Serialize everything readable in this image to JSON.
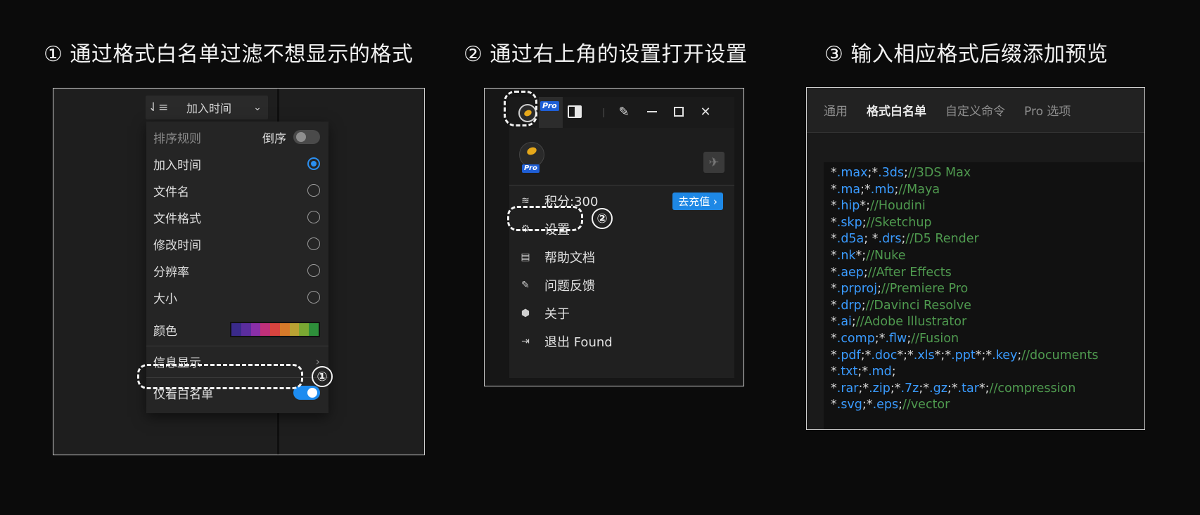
{
  "steps": [
    {
      "title": "① 通过格式白名单过滤不想显示的格式"
    },
    {
      "title": "② 通过右上角的设置打开设置"
    },
    {
      "title": "③ 输入相应格式后缀添加预览"
    }
  ],
  "panel1": {
    "sort_button": {
      "label": "加入时间",
      "icon": "sort-icon",
      "chevron": "chevron-down-icon"
    },
    "menu": {
      "header": "排序规则",
      "descending_label": "倒序",
      "descending_on": false,
      "options": [
        {
          "label": "加入时间",
          "selected": true
        },
        {
          "label": "文件名",
          "selected": false
        },
        {
          "label": "文件格式",
          "selected": false
        },
        {
          "label": "修改时间",
          "selected": false
        },
        {
          "label": "分辨率",
          "selected": false
        },
        {
          "label": "大小",
          "selected": false
        }
      ],
      "color_label": "颜色",
      "palette": [
        "#3a2a8a",
        "#5b2d9e",
        "#8a2fa8",
        "#c0307a",
        "#d9443f",
        "#d67a2a",
        "#b9a233",
        "#7aa832",
        "#2e8f3a"
      ],
      "info_label": "信息显示",
      "whitelist_label": "仅看白名单",
      "whitelist_on": true
    },
    "marker": "①"
  },
  "panel2": {
    "pro_badge": "Pro",
    "avatar_badge": "Pro",
    "menu": [
      {
        "icon": "database-icon",
        "label": "积分:300",
        "action": "去充值 ›"
      },
      {
        "icon": "gear-icon",
        "label": "设置"
      },
      {
        "icon": "document-icon",
        "label": "帮助文档"
      },
      {
        "icon": "feedback-icon",
        "label": "问题反馈"
      },
      {
        "icon": "hexagon-icon",
        "label": "关于"
      },
      {
        "icon": "logout-icon",
        "label": "退出 Found"
      }
    ],
    "marker": "②"
  },
  "panel3": {
    "tabs": [
      {
        "label": "通用",
        "active": false
      },
      {
        "label": "格式白名单",
        "active": true
      },
      {
        "label": "自定义命令",
        "active": false
      },
      {
        "label": "Pro 选项",
        "active": false
      }
    ],
    "code_lines": [
      "*.max;*.3ds;//3DS Max",
      "*.ma;*.mb;//Maya",
      "*.hip*;//Houdini",
      "*.skp;//Sketchup",
      "*.d5a; *.drs;//D5 Render",
      "*.nk*;//Nuke",
      "*.aep;//After Effects",
      "*.prproj;//Premiere Pro",
      "*.drp;//Davinci Resolve",
      "*.ai;//Adobe Illustrator",
      "*.comp;*.flw;//Fusion",
      "*.pdf;*.doc*;*.xls*;*.ppt*;*.key;//documents",
      "*.txt;*.md;",
      "*.rar;*.zip;*.7z;*.gz;*.tar*;//compression",
      "*.svg;*.eps;//vector"
    ]
  }
}
